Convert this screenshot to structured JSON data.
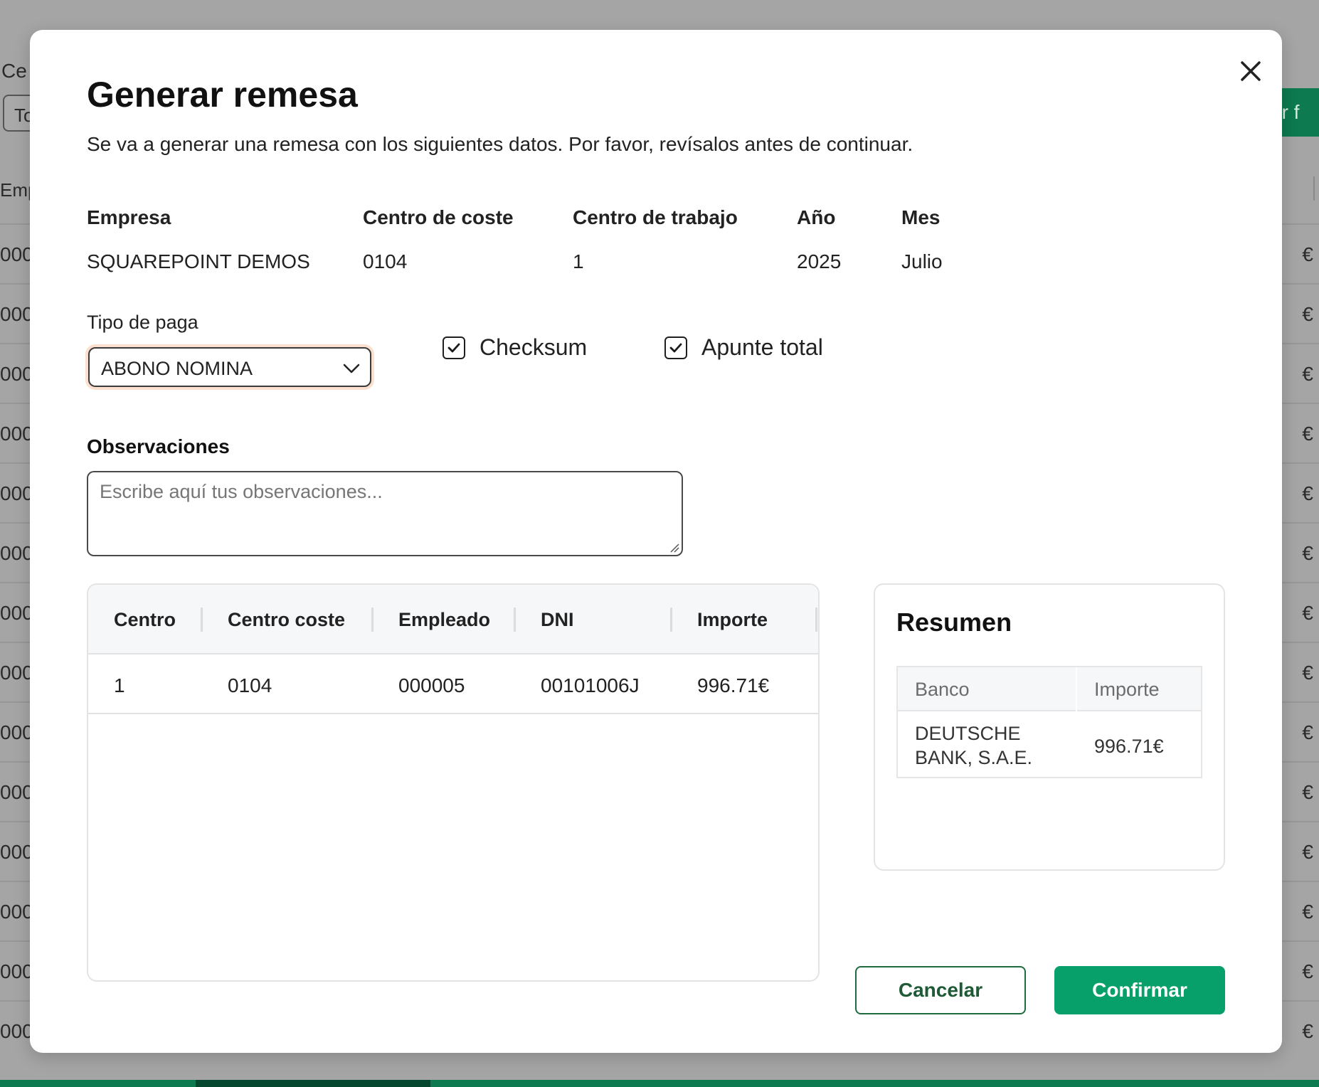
{
  "background": {
    "filter_label": "Ce",
    "filter_select": "To",
    "action_button": "zar f",
    "column_header": "Emp",
    "row_left_text": "000",
    "row_right_text": "€"
  },
  "modal": {
    "title": "Generar remesa",
    "subtitle": "Se va a generar una remesa con los siguientes datos. Por favor, revísalos antes de continuar.",
    "close_icon": "close-icon",
    "info": {
      "empresa": {
        "label": "Empresa",
        "value": "SQUAREPOINT DEMOS"
      },
      "centro_coste": {
        "label": "Centro de coste",
        "value": "0104"
      },
      "centro_trabajo": {
        "label": "Centro de trabajo",
        "value": "1"
      },
      "anio": {
        "label": "Año",
        "value": "2025"
      },
      "mes": {
        "label": "Mes",
        "value": "Julio"
      }
    },
    "tipo_paga": {
      "label": "Tipo de paga",
      "value": "ABONO NOMINA"
    },
    "checksum": {
      "label": "Checksum",
      "checked": true
    },
    "apunte_total": {
      "label": "Apunte total",
      "checked": true
    },
    "observaciones": {
      "label": "Observaciones",
      "placeholder": "Escribe aquí tus observaciones..."
    },
    "table": {
      "headers": [
        "Centro",
        "Centro coste",
        "Empleado",
        "DNI",
        "Importe"
      ],
      "rows": [
        [
          "1",
          "0104",
          "000005",
          "00101006J",
          "996.71€"
        ]
      ]
    },
    "summary": {
      "title": "Resumen",
      "headers": [
        "Banco",
        "Importe"
      ],
      "rows": [
        {
          "banco_line1": "DEUTSCHE",
          "banco_line2": "BANK, S.A.E.",
          "importe": "996.71€"
        }
      ]
    },
    "buttons": {
      "cancel": "Cancelar",
      "confirm": "Confirmar"
    },
    "colors": {
      "accent": "#07a06b",
      "cancel_border": "#1e6b3f",
      "select_focus": "#fbe0cf"
    }
  }
}
